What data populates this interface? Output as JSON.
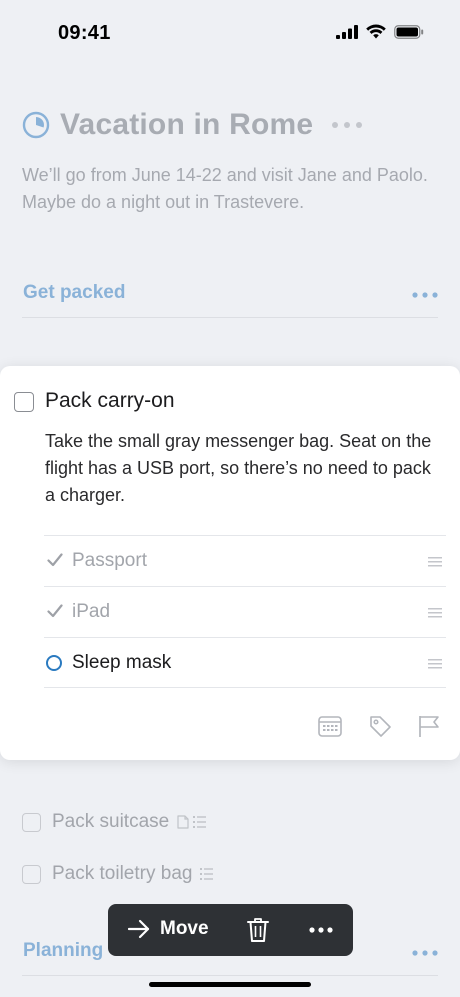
{
  "status_bar": {
    "time": "09:41"
  },
  "project": {
    "title": "Vacation in Rome",
    "notes": "We’ll go from June 14-22 and visit Jane and Paolo. Maybe do a night out in Trastevere.",
    "icon": "progress-pie-icon",
    "accent": "#8ab2d8"
  },
  "sections": [
    {
      "label": "Get packed"
    },
    {
      "label": "Planning"
    }
  ],
  "open_task": {
    "title": "Pack carry-on",
    "notes": "Take the small gray messenger bag. Seat on the flight has a USB port, so there’s no need to pack a charger.",
    "checklist": [
      {
        "label": "Passport",
        "done": true
      },
      {
        "label": "iPad",
        "done": true
      },
      {
        "label": "Sleep mask",
        "done": false
      }
    ],
    "toolbar": [
      "calendar-icon",
      "tag-icon",
      "flag-icon"
    ]
  },
  "tasks": [
    {
      "label": "Pack suitcase",
      "meta": [
        "note-icon",
        "checklist-icon"
      ]
    },
    {
      "label": "Pack toiletry bag",
      "meta": [
        "checklist-icon"
      ]
    }
  ],
  "action_bar": {
    "move_label": "Move",
    "icons": [
      "arrow-right-icon",
      "trash-icon",
      "more-icon"
    ],
    "background": "#2e3135"
  }
}
